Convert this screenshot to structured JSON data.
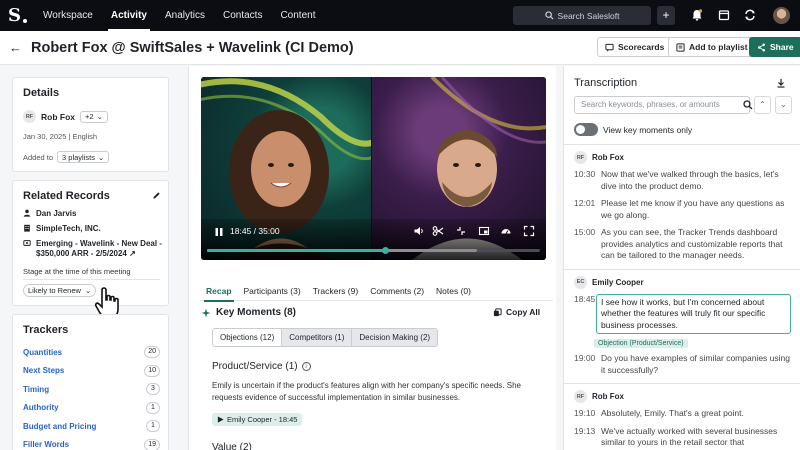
{
  "nav": {
    "logo": "S",
    "items": [
      "Workspace",
      "Activity",
      "Analytics",
      "Contacts",
      "Content"
    ],
    "active": "Activity",
    "search_label": "Search Salesloft",
    "plus": "+"
  },
  "header": {
    "title": "Robert Fox @ SwiftSales + Wavelink (CI Demo)",
    "scorecards": "Scorecards",
    "add_to_playlist": "Add to playlist",
    "share": "Share"
  },
  "details": {
    "title": "Details",
    "owner_initials": "RF",
    "owner_name": "Rob Fox",
    "participants_more": "+2",
    "meta": "Jan 30, 2025 | English",
    "added_to_label": "Added to",
    "playlists": "3 playlists"
  },
  "related": {
    "title": "Related Records",
    "contact": "Dan Jarvis",
    "account": "SimpleTech, INC.",
    "deal_line1": "Emerging - Wavelink - New Deal -",
    "deal_line2": "$350,000 ARR - 2/5/2024",
    "stage_label": "Stage at the time of this meeting",
    "stage_value": "Likely to Renew"
  },
  "trackers": {
    "title": "Trackers",
    "items": [
      {
        "name": "Quantities",
        "count": "20"
      },
      {
        "name": "Next Steps",
        "count": "10"
      },
      {
        "name": "Timing",
        "count": "3"
      },
      {
        "name": "Authority",
        "count": "1"
      },
      {
        "name": "Budget and Pricing",
        "count": "1"
      },
      {
        "name": "Filler Words",
        "count": "19"
      }
    ]
  },
  "video": {
    "time": "18:45 / 35:00",
    "played_fraction": 0.536,
    "buffered_fraction": 0.81
  },
  "tabs": [
    "Recap",
    "Participants (3)",
    "Trackers (9)",
    "Comments (2)",
    "Notes (0)"
  ],
  "active_tab": "Recap",
  "key_moments": {
    "title": "Key Moments (8)",
    "copy_all": "Copy All",
    "segments": [
      "Objections (12)",
      "Competitors (1)",
      "Decision Making (2)"
    ],
    "active_segment": "Objections (12)",
    "section1_title": "Product/Service (1)",
    "section1_body": "Emily is uncertain if the product's features align with her company's specific needs. She requests evidence of successful implementation in similar businesses.",
    "speaker_chip": "Emily Cooper - 18:45",
    "section2_title": "Value (2)"
  },
  "transcription": {
    "title": "Transcription",
    "search_placeholder": "Search keywords, phrases, or amounts",
    "toggle_label": "View key moments only",
    "blocks": [
      {
        "initials": "RF",
        "speaker": "Rob Fox",
        "lines": [
          {
            "time": "10:30",
            "text": "Now that we've walked through the basics, let's dive into the product demo."
          },
          {
            "time": "12:01",
            "text": "Please let me know if you have any questions as we go along."
          },
          {
            "time": "15:00",
            "text": "As you can see, the Tracker Trends dashboard provides analytics and customizable reports that can be tailored to the manager needs."
          }
        ]
      },
      {
        "initials": "EC",
        "speaker": "Emily Cooper",
        "highlight": {
          "time": "18:45",
          "text": "I see how it works, but I'm concerned about whether the features will truly fit our specific business processes.",
          "tag": "Objection (Product/Service)"
        },
        "lines": [
          {
            "time": "19:00",
            "text": "Do you have examples of similar companies using it successfully?"
          }
        ]
      },
      {
        "initials": "RF",
        "speaker": "Rob Fox",
        "lines": [
          {
            "time": "19:10",
            "text": "Absolutely, Emily. That's a great point."
          },
          {
            "time": "19:13",
            "text": "We've actually worked with several businesses similar to yours in the retail sector that"
          }
        ]
      }
    ]
  },
  "colors": {
    "accent": "#1d6f5b",
    "highlight_border": "#3fae9d",
    "link": "#2b63c8",
    "nav_bg": "#0b0d12"
  }
}
